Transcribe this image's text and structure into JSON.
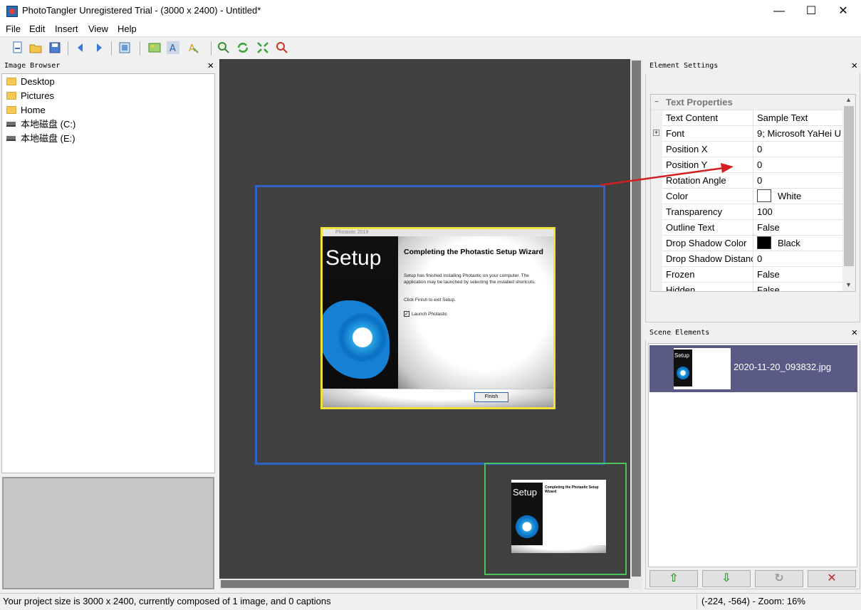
{
  "window": {
    "title": "PhotoTangler Unregistered Trial - (3000 x 2400) - Untitled*",
    "minimize": "—",
    "maximize": "☐",
    "close": "✕"
  },
  "menu": [
    "File",
    "Edit",
    "Insert",
    "View",
    "Help"
  ],
  "toolbar_icons": [
    "new-icon",
    "open-icon",
    "save-icon",
    "back-icon",
    "forward-icon",
    "layout-icon",
    "add-image-icon",
    "add-text-icon",
    "text-effect-icon",
    "zoom-in-icon",
    "refresh-icon",
    "fit-icon",
    "zoom-out-icon"
  ],
  "image_browser": {
    "title": "Image Browser",
    "items": [
      {
        "label": "Desktop",
        "icon": "folder-icon"
      },
      {
        "label": "Pictures",
        "icon": "folder-icon"
      },
      {
        "label": "Home",
        "icon": "folder-icon"
      },
      {
        "label": "本地磁盘 (C:)",
        "icon": "drive-icon"
      },
      {
        "label": "本地磁盘 (E:)",
        "icon": "drive-icon"
      }
    ]
  },
  "canvas": {
    "wizard_title": "Photastic 2019",
    "setup_word": "Setup",
    "heading": "Completing the Photastic Setup Wizard",
    "para1": "Setup has finished installing Photastic on your computer. The application may be launched by selecting the installed shortcuts.",
    "para2": "Click Finish to exit Setup.",
    "checkbox": "Launch Photastic",
    "finish": "Finish"
  },
  "element_settings": {
    "title": "Element Settings",
    "group": "Text Properties",
    "props": [
      {
        "name": "Text Content",
        "value": "Sample Text"
      },
      {
        "name": "Font",
        "value": "9; Microsoft YaHei U"
      },
      {
        "name": "Position X",
        "value": "0"
      },
      {
        "name": "Position Y",
        "value": "0"
      },
      {
        "name": "Rotation Angle",
        "value": "0"
      },
      {
        "name": "Color",
        "value": "White",
        "swatch": "#ffffff"
      },
      {
        "name": "Transparency",
        "value": "100"
      },
      {
        "name": "Outline Text",
        "value": "False"
      },
      {
        "name": "Drop Shadow Color",
        "value": "Black",
        "swatch": "#000000"
      },
      {
        "name": "Drop Shadow Distance",
        "value": "0"
      },
      {
        "name": "Frozen",
        "value": "False"
      },
      {
        "name": "Hidden",
        "value": "False"
      }
    ]
  },
  "scene_elements": {
    "title": "Scene Elements",
    "items": [
      {
        "label": "2020-11-20_093832.jpg"
      }
    ],
    "buttons": [
      "⇧",
      "⇩",
      "↻",
      "✕"
    ]
  },
  "status": {
    "left": "Your project size is 3000 x 2400, currently composed of 1 image, and 0 captions",
    "right": "(-224, -564) - Zoom: 16%"
  },
  "colors": {
    "selection_blue": "#3162c8",
    "selection_yellow": "#f0e23a",
    "selection_green": "#4ac45a",
    "arrow_red": "#d21f1f",
    "scene_selected": "#5a5a86"
  }
}
